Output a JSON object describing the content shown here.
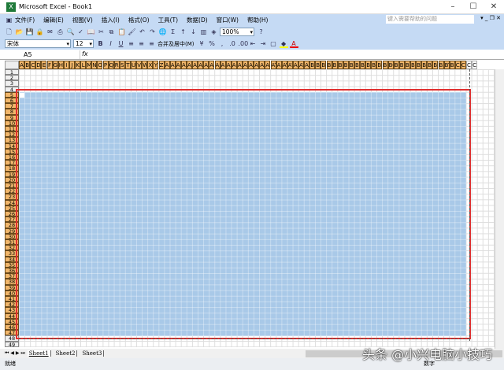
{
  "window": {
    "title": "Microsoft Excel - Book1",
    "min": "–",
    "max": "☐",
    "close": "✕"
  },
  "menu": [
    "文件(F)",
    "编辑(E)",
    "视图(V)",
    "插入(I)",
    "格式(O)",
    "工具(T)",
    "数据(D)",
    "窗口(W)",
    "帮助(H)"
  ],
  "help_placeholder": "键入需要帮助的问题",
  "zoom": "100%",
  "font": "宋体",
  "font_size": "12",
  "merge_label": "合并及居中(M)",
  "namebox": "A5",
  "fx": "fx",
  "columns": [
    "A",
    "B",
    "C",
    "D",
    "E",
    "F",
    "G",
    "H",
    "I",
    "J",
    "K",
    "L",
    "M",
    "N",
    "O",
    "P",
    "Q",
    "R",
    "S",
    "T",
    "U",
    "V",
    "W",
    "X",
    "Y",
    "Z",
    "AA",
    "AB",
    "AC",
    "AD",
    "AE",
    "AF",
    "AG",
    "AH",
    "AI",
    "AJ",
    "AK",
    "AL",
    "AM",
    "AN",
    "AO",
    "AP",
    "AQ",
    "AR",
    "AS",
    "AT",
    "AU",
    "AV",
    "AW",
    "AX",
    "AY",
    "AZ",
    "BA",
    "BB",
    "BC",
    "BD",
    "BE",
    "BF",
    "BG",
    "BH",
    "BI",
    "BJ",
    "BK",
    "BL",
    "BM",
    "BN",
    "BO",
    "BP",
    "BQ",
    "BR",
    "BS",
    "BT",
    "BU",
    "BV",
    "BW",
    "BX",
    "BY",
    "BZ",
    "CA",
    "CB",
    "CC",
    "CD"
  ],
  "selected_columns": 80,
  "rows": 49,
  "selected_rows": [
    5,
    47
  ],
  "sheets": [
    "Sheet1",
    "Sheet2",
    "Sheet3"
  ],
  "status": {
    "ready": "就绪",
    "num": "数字"
  },
  "watermark": "头条 @小兴电脑小技巧"
}
